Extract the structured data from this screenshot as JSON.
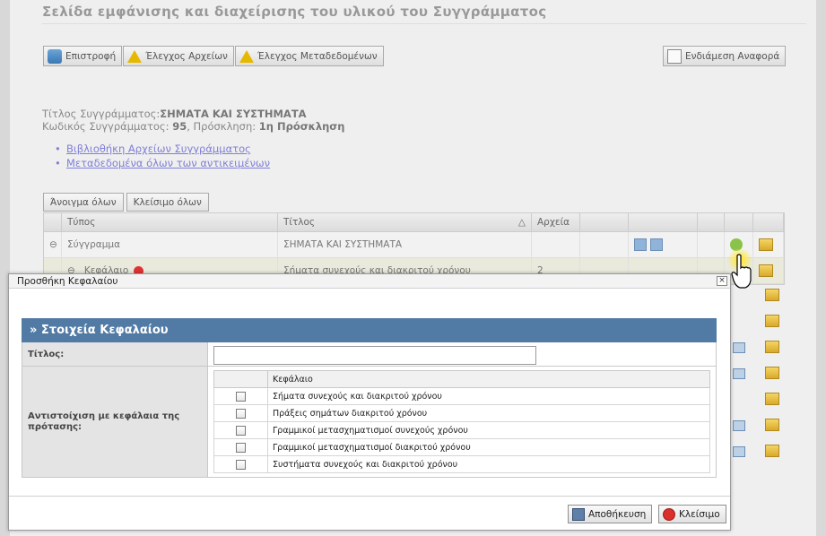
{
  "background": {
    "page_title": "Σελίδα εμφάνισης και διαχείρισης του υλικού του Συγγράμματος",
    "toolbar": {
      "back": "Επιστροφή",
      "check_files": "Έλεγχος Αρχείων",
      "check_metadata": "Έλεγχος Μεταδεδομένων",
      "interim_report": "Ενδιάμεση Αναφορά"
    },
    "meta": {
      "title_label": "Τίτλος Συγγράμματος:",
      "title_value": "ΣΗΜΑΤΑ ΚΑΙ ΣΥΣΤΗΜΑΤΑ",
      "code_label": "Κωδικός Συγγράμματος:",
      "code_value": "95",
      "call_label": ", Πρόσκληση:",
      "call_value": "1η Πρόσκληση"
    },
    "links": [
      "Βιβλιοθήκη Αρχείων Συγγράμματος",
      "Μεταδεδομένα όλων των αντικειμένων"
    ],
    "tree_buttons": {
      "expand_all": "Άνοιγμα όλων",
      "collapse_all": "Κλείσιμο όλων"
    },
    "grid": {
      "headers": [
        "Τύπος",
        "Τίτλος",
        "Αρχεία"
      ],
      "rows": [
        {
          "type": "Σύγγραμμα",
          "title": "ΣΗΜΑΤΑ ΚΑΙ ΣΥΣΤΗΜΑΤΑ",
          "files": ""
        },
        {
          "type": "Κεφάλαιο",
          "title": "Σήματα συνεχούς και διακριτού χρόνου",
          "files": "2"
        }
      ],
      "sort_indicator": "△"
    }
  },
  "dialog": {
    "window_title": "Προσθήκη Κεφαλαίου",
    "close_glyph": "×",
    "section_title": "» Στοιχεία Κεφαλαίου",
    "title_label": "Τίτλος:",
    "title_value": "",
    "mapping_label": "Αντιστοίχιση με κεφάλαια της πρότασης:",
    "chapters_header": "Κεφάλαιο",
    "chapters": [
      {
        "label": "Σήματα συνεχούς και διακριτού χρόνου",
        "checked": false
      },
      {
        "label": "Πράξεις σημάτων διακριτού χρόνου",
        "checked": false
      },
      {
        "label": "Γραμμικοί μετασχηματισμοί συνεχούς χρόνου",
        "checked": false
      },
      {
        "label": "Γραμμικοί μετασχηματισμοί διακριτού χρόνου",
        "checked": false
      },
      {
        "label": "Συστήματα συνεχούς και διακριτού χρόνου",
        "checked": false
      }
    ],
    "save_label": "Αποθήκευση",
    "close_label": "Κλείσιμο"
  },
  "colors": {
    "section_header": "#517aa5",
    "link": "#7f7fd8",
    "overlay_page": "#efefef"
  }
}
